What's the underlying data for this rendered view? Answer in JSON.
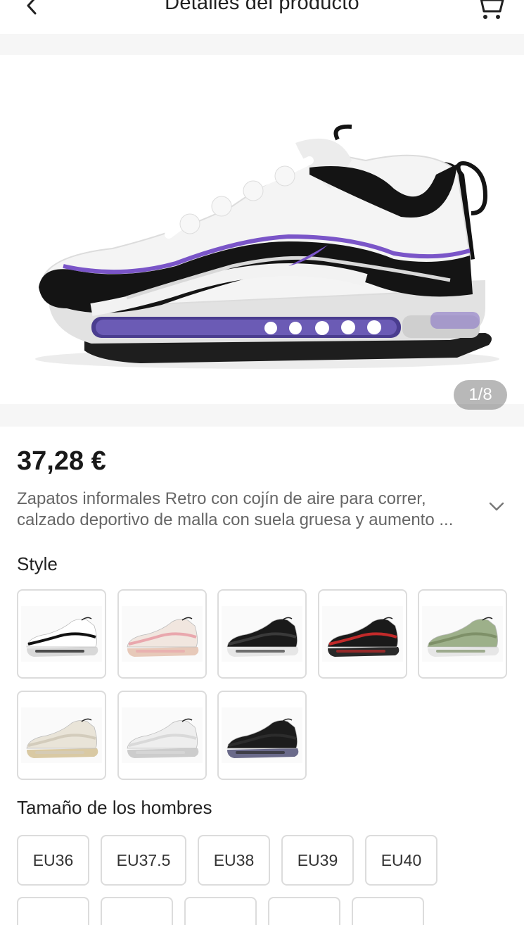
{
  "header": {
    "title": "Detalles del producto",
    "back_icon": "chevron-left-icon",
    "cart_icon": "shopping-cart-icon"
  },
  "gallery": {
    "indicator": "1/8",
    "colors": {
      "upper": "#f2f2f2",
      "black": "#141414",
      "accent_purple": "#7a55c8",
      "sole_gray": "#cfcfcf"
    }
  },
  "product": {
    "price": "37,28 €",
    "description_line1": "Zapatos informales Retro con cojín de aire para correr,",
    "description_line2": "calzado deportivo de malla con suela gruesa y aumento ...",
    "expand_icon": "chevron-down-icon"
  },
  "style": {
    "label": "Style",
    "variants": [
      {
        "name": "white-black",
        "upper": "#ffffff",
        "trim": "#111111",
        "sole": "#d8d8d8"
      },
      {
        "name": "pink-cream",
        "upper": "#f1e6df",
        "trim": "#e9a7ad",
        "sole": "#e7c9b9"
      },
      {
        "name": "all-black",
        "upper": "#1a1a1a",
        "trim": "#3a3a3a",
        "sole": "#e6e6e6"
      },
      {
        "name": "black-red",
        "upper": "#1a1a1a",
        "trim": "#c22a2a",
        "sole": "#2a2a2a"
      },
      {
        "name": "olive-green",
        "upper": "#9db08a",
        "trim": "#7e9068",
        "sole": "#e6e6e6"
      },
      {
        "name": "cream",
        "upper": "#e9e4d8",
        "trim": "#d3ccbc",
        "sole": "#d9c9a3"
      },
      {
        "name": "light-gray",
        "upper": "#eeeeee",
        "trim": "#d9d9d9",
        "sole": "#cccccc"
      },
      {
        "name": "black-gray",
        "upper": "#1c1c1c",
        "trim": "#2c2c2c",
        "sole": "#6a6a8a"
      }
    ]
  },
  "size": {
    "label": "Tamaño de los hombres",
    "options": [
      "EU36",
      "EU37.5",
      "EU38",
      "EU39",
      "EU40"
    ]
  }
}
